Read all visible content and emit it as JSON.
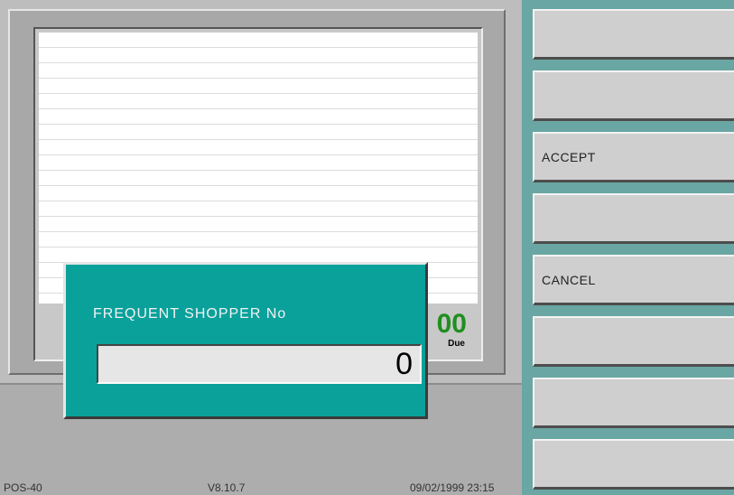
{
  "receipt": {
    "total_amount": "00",
    "total_label": "Due"
  },
  "function_keys": [
    "",
    "",
    "ACCEPT",
    "",
    "CANCEL",
    "",
    "",
    ""
  ],
  "dialog": {
    "title": "FREQUENT SHOPPER No",
    "value": "0"
  },
  "status_bar": {
    "terminal": "POS-40",
    "version": "V8.10.7",
    "datetime": "09/02/1999 23:15"
  }
}
